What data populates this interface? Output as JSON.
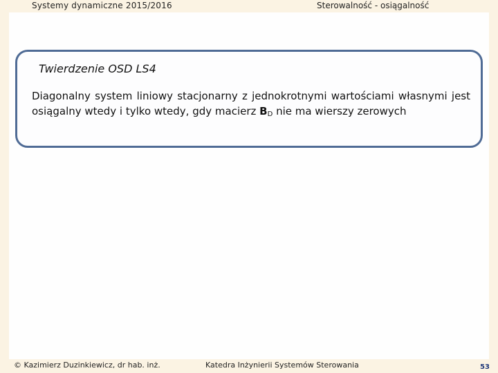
{
  "header": {
    "course": "Systemy dynamiczne 2015/2016",
    "topic": "Sterowalność - osiągalność"
  },
  "theorem": {
    "title": "Twierdzenie OSD LS4",
    "body_before": "Diagonalny system liniowy stacjonarny z jednokrotnymi wartościami własnymi jest osiągalny wtedy i tylko wtedy, gdy macierz ",
    "matrix_symbol": "B",
    "matrix_subscript": "D",
    "body_after": " nie ma wierszy zerowych"
  },
  "footer": {
    "author": "© Kazimierz Duzinkiewicz, dr hab. inż.",
    "department": "Katedra Inżynierii Systemów Sterowania",
    "page_number": "53"
  }
}
